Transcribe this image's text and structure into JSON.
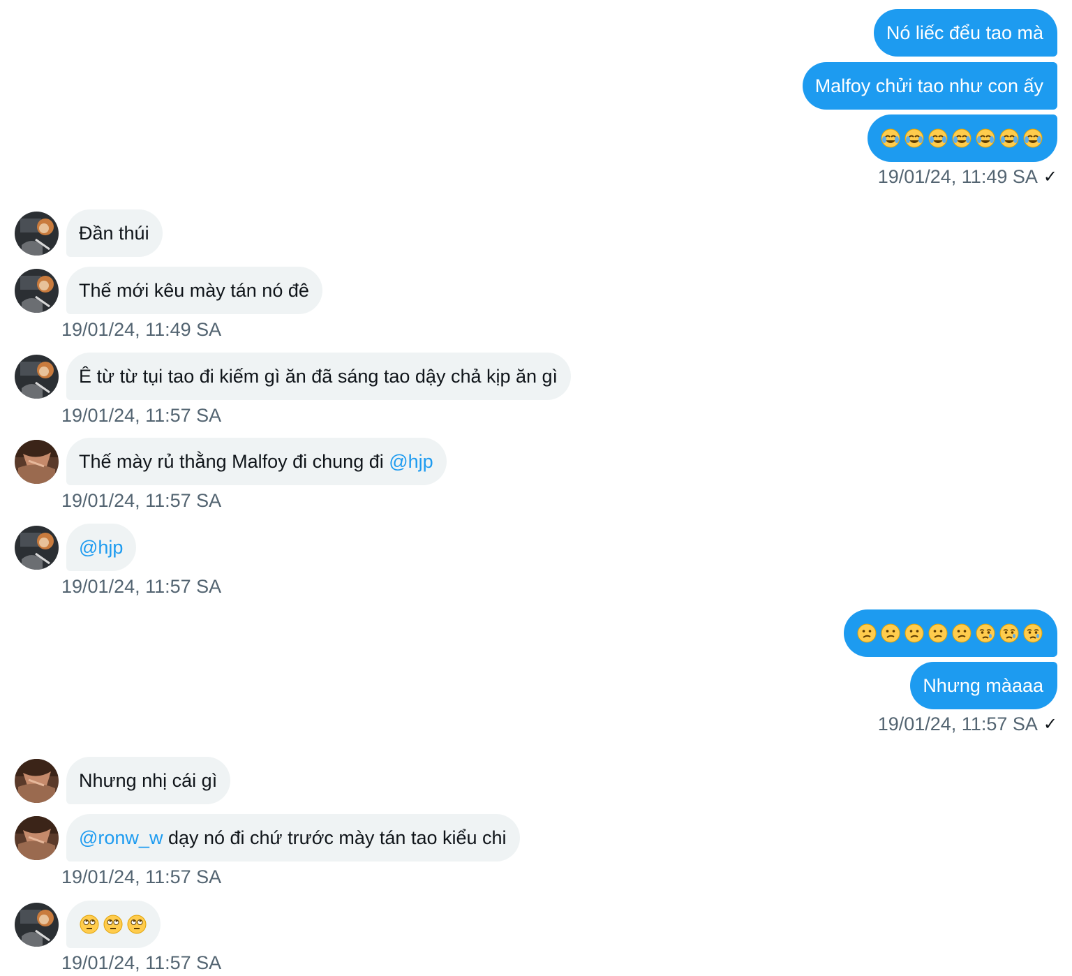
{
  "messages": {
    "out1": {
      "b1": "Nó liếc đểu tao mà",
      "b2": "Malfoy chửi tao như con ấy",
      "b3_emoji": [
        "crying-laughing-face",
        "crying-laughing-face",
        "crying-laughing-face",
        "crying-laughing-face",
        "crying-laughing-face",
        "crying-laughing-face",
        "crying-laughing-face"
      ],
      "time": "19/01/24, 11:49 SA",
      "check": "✓"
    },
    "in1": {
      "b1": "Đần thúi",
      "b2": "Thế mới kêu mày tán nó đê",
      "time": "19/01/24, 11:49 SA"
    },
    "in2": {
      "b1": "Ê từ từ tụi tao đi kiếm gì ăn đã sáng tao dậy chả kịp ăn gì",
      "time": "19/01/24, 11:57 SA"
    },
    "in3": {
      "b1_text": "Thế mày rủ thằng Malfoy đi chung đi ",
      "b1_mention": "@hjp",
      "time": "19/01/24, 11:57 SA"
    },
    "in4": {
      "b1_mention": "@hjp",
      "time": "19/01/24, 11:57 SA"
    },
    "out2": {
      "b1_emoji": [
        "confused-face",
        "confused-face",
        "confused-face",
        "confused-face",
        "confused-face",
        "crying-face",
        "crying-face",
        "crying-face"
      ],
      "b2": "Nhưng màaaa",
      "time": "19/01/24, 11:57 SA",
      "check": "✓"
    },
    "in5": {
      "b1": "Nhưng nhị cái gì",
      "time": null
    },
    "in6": {
      "b1_mention": "@ronw_w",
      "b1_text": " dạy nó đi chứ trước mày tán tao kiểu chi",
      "time": "19/01/24, 11:57 SA"
    },
    "in7": {
      "b1_emoji": [
        "eye-roll-face",
        "eye-roll-face",
        "eye-roll-face"
      ],
      "time": "19/01/24, 11:57 SA"
    }
  },
  "colors": {
    "outgoing_bubble": "#1d9bf0",
    "incoming_bubble": "#eff3f4",
    "mention": "#1d9bf0",
    "timestamp": "#536471"
  },
  "avatars": {
    "a": "avatar-dark-photo",
    "b": "avatar-brown-photo"
  }
}
